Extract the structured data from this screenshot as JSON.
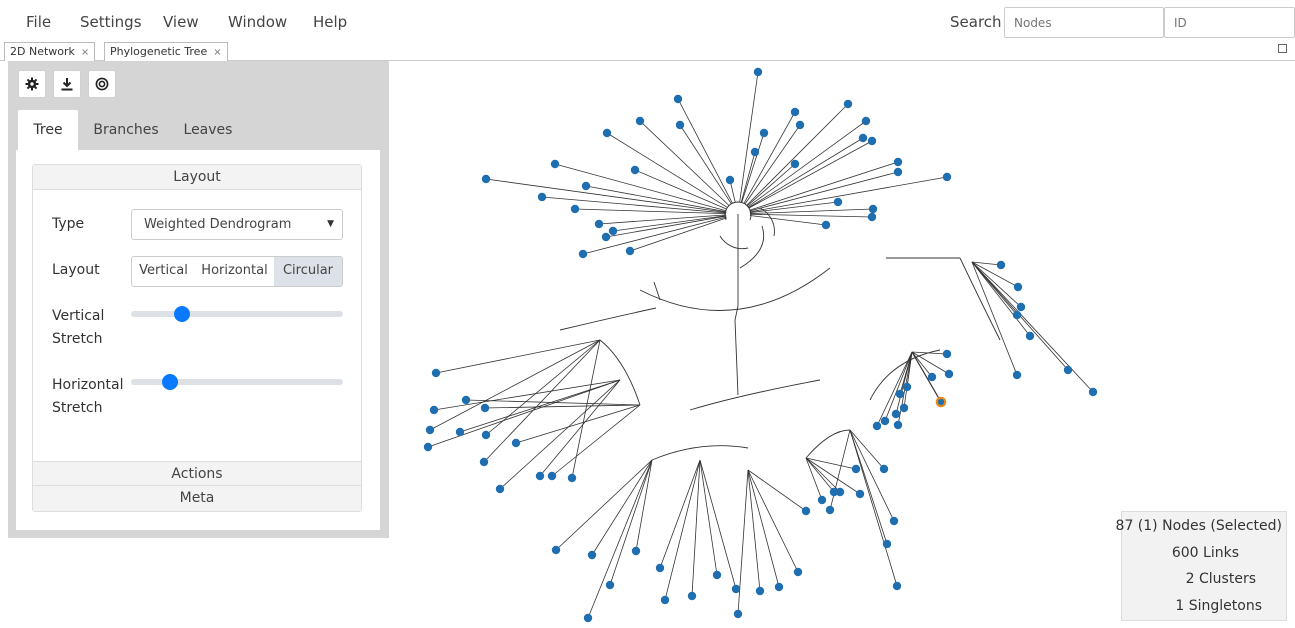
{
  "menu": {
    "items": [
      "File",
      "Settings",
      "View",
      "Window",
      "Help"
    ],
    "search_label": "Search",
    "search_nodes_placeholder": "Nodes",
    "search_id_placeholder": "ID"
  },
  "tabs": [
    {
      "label": "2D Network",
      "close": "×"
    },
    {
      "label": "Phylogenetic Tree",
      "close": "×"
    }
  ],
  "toolbar": {
    "buttons": [
      "gear-icon",
      "download-icon",
      "target-icon"
    ]
  },
  "panel": {
    "tabs": [
      "Tree",
      "Branches",
      "Leaves"
    ],
    "active_tab": "Tree",
    "layout_section": "Layout",
    "type_label": "Type",
    "type_value": "Weighted Dendrogram",
    "layout_label": "Layout",
    "layout_options": [
      "Vertical",
      "Horizontal",
      "Circular"
    ],
    "layout_selected": "Circular",
    "vstretch_label_1": "Vertical",
    "vstretch_label_2": "Stretch",
    "vstretch_value": 0.22,
    "hstretch_label_1": "Horizontal",
    "hstretch_label_2": "Stretch",
    "hstretch_value": 0.16,
    "actions_section": "Actions",
    "meta_section": "Meta"
  },
  "stats": {
    "nodes_num": "87 (1)",
    "nodes_label": "Nodes (Selected)",
    "links_num": "600",
    "links_label": "Links",
    "clusters_num": "2",
    "clusters_label": "Clusters",
    "singletons_num": "1",
    "singletons_label": "Singletons"
  },
  "colors": {
    "node": "#1f6fb0",
    "selected_node": "#e88a1a",
    "accent": "#0a79ff",
    "branch": "#333333"
  }
}
